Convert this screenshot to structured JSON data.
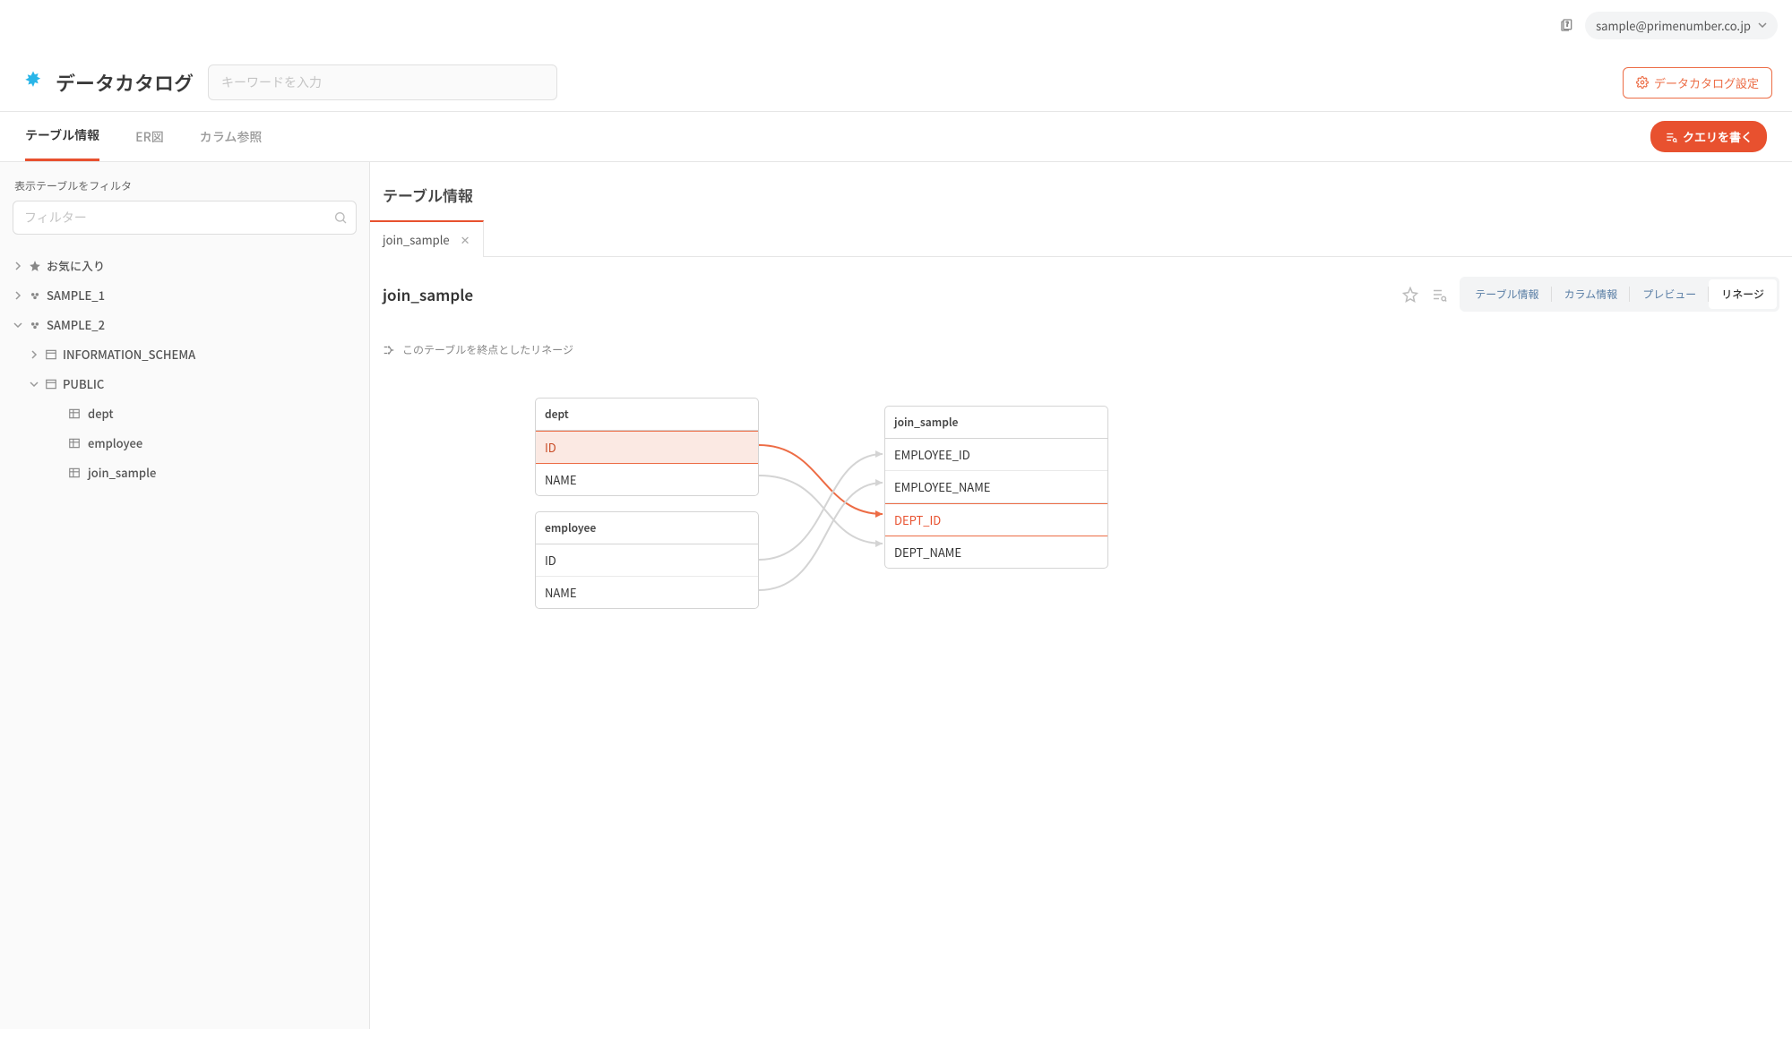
{
  "topbar": {
    "user": "sample@primenumber.co.jp"
  },
  "header": {
    "app_title": "データカタログ",
    "search_placeholder": "キーワードを入力",
    "settings_label": "データカタログ設定"
  },
  "nav": {
    "tabs": [
      {
        "label": "テーブル情報",
        "active": true
      },
      {
        "label": "ER図",
        "active": false
      },
      {
        "label": "カラム参照",
        "active": false
      }
    ],
    "query_button": "クエリを書く"
  },
  "sidebar": {
    "filter_title": "表示テーブルをフィルタ",
    "filter_placeholder": "フィルター",
    "favorites_label": "お気に入り",
    "tree": [
      {
        "label": "SAMPLE_1",
        "expanded": false
      },
      {
        "label": "SAMPLE_2",
        "expanded": true,
        "children": [
          {
            "label": "INFORMATION_SCHEMA",
            "expanded": false,
            "type": "schema"
          },
          {
            "label": "PUBLIC",
            "expanded": true,
            "type": "schema",
            "tables": [
              "dept",
              "employee",
              "join_sample"
            ]
          }
        ]
      }
    ]
  },
  "content": {
    "section_title": "テーブル情報",
    "open_tab": "join_sample",
    "detail_title": "join_sample",
    "view_tabs": [
      "テーブル情報",
      "カラム情報",
      "プレビュー",
      "リネージ"
    ],
    "view_active": "リネージ",
    "lineage_note": "このテーブルを終点としたリネージ",
    "lineage": {
      "sources": [
        {
          "name": "dept",
          "columns": [
            "ID",
            "NAME"
          ],
          "highlight_col": "ID"
        },
        {
          "name": "employee",
          "columns": [
            "ID",
            "NAME"
          ]
        }
      ],
      "target": {
        "name": "join_sample",
        "columns": [
          "EMPLOYEE_ID",
          "EMPLOYEE_NAME",
          "DEPT_ID",
          "DEPT_NAME"
        ],
        "highlight_col": "DEPT_ID"
      },
      "edges": [
        {
          "from": "dept.ID",
          "to": "join_sample.DEPT_ID",
          "highlight": true
        },
        {
          "from": "dept.NAME",
          "to": "join_sample.DEPT_NAME",
          "highlight": false
        },
        {
          "from": "employee.ID",
          "to": "join_sample.EMPLOYEE_ID",
          "highlight": false
        },
        {
          "from": "employee.NAME",
          "to": "join_sample.EMPLOYEE_NAME",
          "highlight": false
        }
      ]
    }
  }
}
